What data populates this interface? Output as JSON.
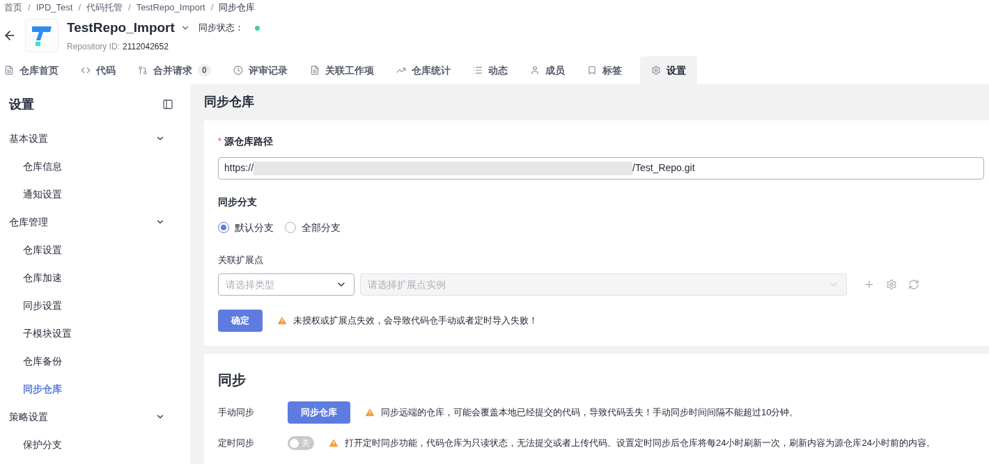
{
  "breadcrumb": {
    "separator": "/",
    "items": [
      "首页",
      "IPD_Test",
      "代码托管",
      "TestRepo_Import",
      "同步仓库"
    ]
  },
  "repo": {
    "name": "TestRepo_Import",
    "sync_status_label": "同步状态：",
    "synced": true,
    "id_label": "Repository ID:",
    "id": "2112042652"
  },
  "tabs": [
    {
      "kind": "home",
      "label": "仓库首页",
      "selected": false
    },
    {
      "kind": "code",
      "label": "代码",
      "selected": false
    },
    {
      "kind": "merge",
      "label": "合并请求",
      "count": "0",
      "selected": false
    },
    {
      "kind": "review",
      "label": "评审记录",
      "selected": false
    },
    {
      "kind": "doc",
      "label": "关联工作项",
      "selected": false
    },
    {
      "kind": "stats",
      "label": "仓库统计",
      "selected": false
    },
    {
      "kind": "list",
      "label": "动态",
      "selected": false
    },
    {
      "kind": "user",
      "label": "成员",
      "selected": false
    },
    {
      "kind": "tag",
      "label": "标签",
      "selected": false
    },
    {
      "kind": "settings",
      "label": "设置",
      "selected": true
    }
  ],
  "sidebar": {
    "title": "设置",
    "groups": [
      {
        "label": "基本设置",
        "expanded": true,
        "children": [
          {
            "label": "仓库信息",
            "selected": false
          },
          {
            "label": "通知设置",
            "selected": false
          }
        ]
      },
      {
        "label": "仓库管理",
        "expanded": true,
        "children": [
          {
            "label": "仓库设置",
            "selected": false
          },
          {
            "label": "仓库加速",
            "selected": false
          },
          {
            "label": "同步设置",
            "selected": false
          },
          {
            "label": "子模块设置",
            "selected": false
          },
          {
            "label": "仓库备份",
            "selected": false
          },
          {
            "label": "同步仓库",
            "selected": true
          }
        ]
      },
      {
        "label": "策略设置",
        "expanded": true,
        "children": [
          {
            "label": "保护分支",
            "selected": false
          }
        ]
      }
    ]
  },
  "page_title": "同步仓库",
  "source_form": {
    "path_label": "源仓库路径",
    "required_mark": "*",
    "url_prefix": "https://",
    "url_suffix": "/Test_Repo.git",
    "branch_label": "同步分支",
    "branch_options": [
      {
        "label": "默认分支",
        "selected": true
      },
      {
        "label": "全部分支",
        "selected": false
      }
    ],
    "extension_label": "关联扩展点",
    "type_select": {
      "placeholder": "请选择类型",
      "disabled": false
    },
    "instance_select": {
      "placeholder": "请选择扩展点实例",
      "disabled": true
    },
    "confirm_button": "确定",
    "warning": "未授权或扩展点失效，会导致代码仓手动或者定时导入失败！"
  },
  "sync_section": {
    "title": "同步",
    "rows": [
      {
        "kind": "button",
        "label": "手动同步",
        "button": "同步仓库",
        "warning": "同步远端的仓库，可能会覆盖本地已经提交的代码，导致代码丢失！手动同步时间间隔不能超过10分钟。"
      },
      {
        "kind": "switch",
        "label": "定时同步",
        "on": false,
        "switch_text": "关",
        "warning": "打开定时同步功能，代码仓库为只读状态，无法提交或者上传代码。设置定时同步后仓库将每24小时刷新一次，刷新内容为源仓库24小时前的内容。"
      }
    ]
  }
}
